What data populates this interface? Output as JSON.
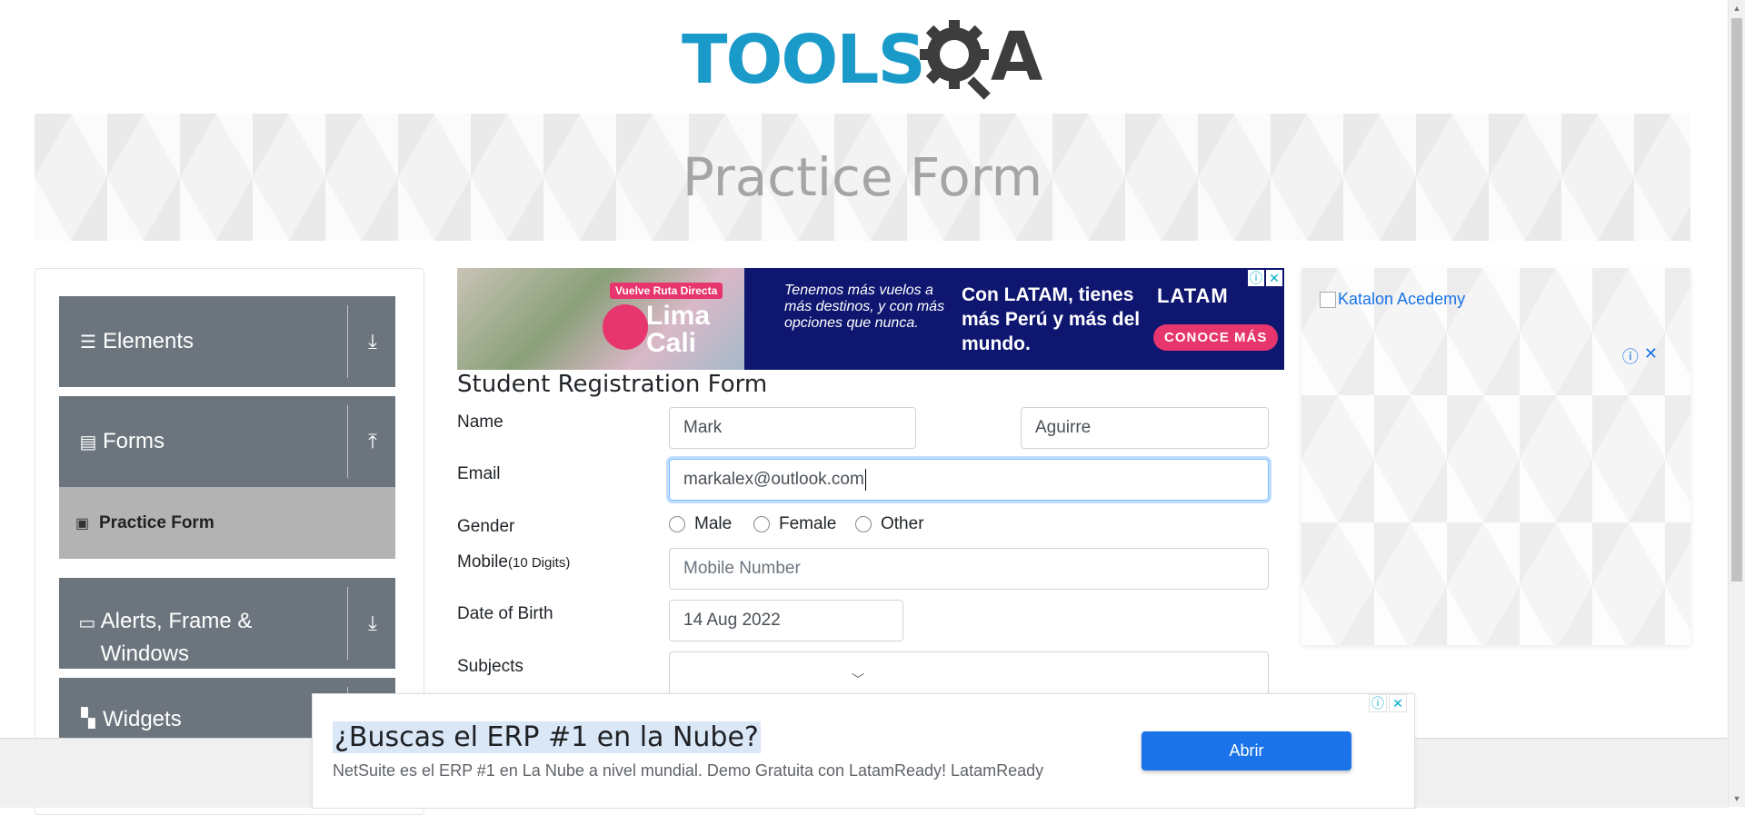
{
  "logo": {
    "text_left": "TOOLS",
    "text_right": "A",
    "accent": "#1a9ac9",
    "dark": "#3d3d3d"
  },
  "banner": {
    "title": "Practice Form"
  },
  "sidebar": {
    "groups": [
      {
        "label": "Elements",
        "icon": "hamburger-icon",
        "arrow": "⤓"
      },
      {
        "label": "Forms",
        "icon": "document-icon",
        "arrow": "⤒"
      },
      {
        "label": "Alerts, Frame & Windows",
        "icon": "window-icon",
        "arrow": "⤓"
      },
      {
        "label": "Widgets",
        "icon": "widgets-icon"
      }
    ],
    "active_item": {
      "label": "Practice Form",
      "icon": "form-icon"
    }
  },
  "ad_top": {
    "badge": "Vuelve Ruta Directa",
    "destination": "Lima Cali",
    "tagline": "Tenemos más vuelos a más destinos, y con más opciones que nunca.",
    "headline": "Con LATAM, tienes más Perú y más del mundo.",
    "brand": "LATAM",
    "cta": "CONOCE MÁS"
  },
  "form": {
    "title": "Student Registration Form",
    "name_label": "Name",
    "first_name": "Mark",
    "last_name": "Aguirre",
    "email_label": "Email",
    "email": "markalex@outlook.com",
    "gender_label": "Gender",
    "gender_options": [
      "Male",
      "Female",
      "Other"
    ],
    "mobile_label": "Mobile",
    "mobile_hint": "(10 Digits)",
    "mobile_placeholder": "Mobile Number",
    "dob_label": "Date of Birth",
    "dob": "14 Aug 2022",
    "subjects_label": "Subjects"
  },
  "ad_right": {
    "alt_text": "Katalon Acedemy"
  },
  "ad_bottom": {
    "title": "¿Buscas el ERP #1 en la Nube?",
    "description": "NetSuite es el ERP #1 en La Nube a nivel mundial. Demo Gratuita con LatamReady! LatamReady",
    "button": "Abrir"
  }
}
